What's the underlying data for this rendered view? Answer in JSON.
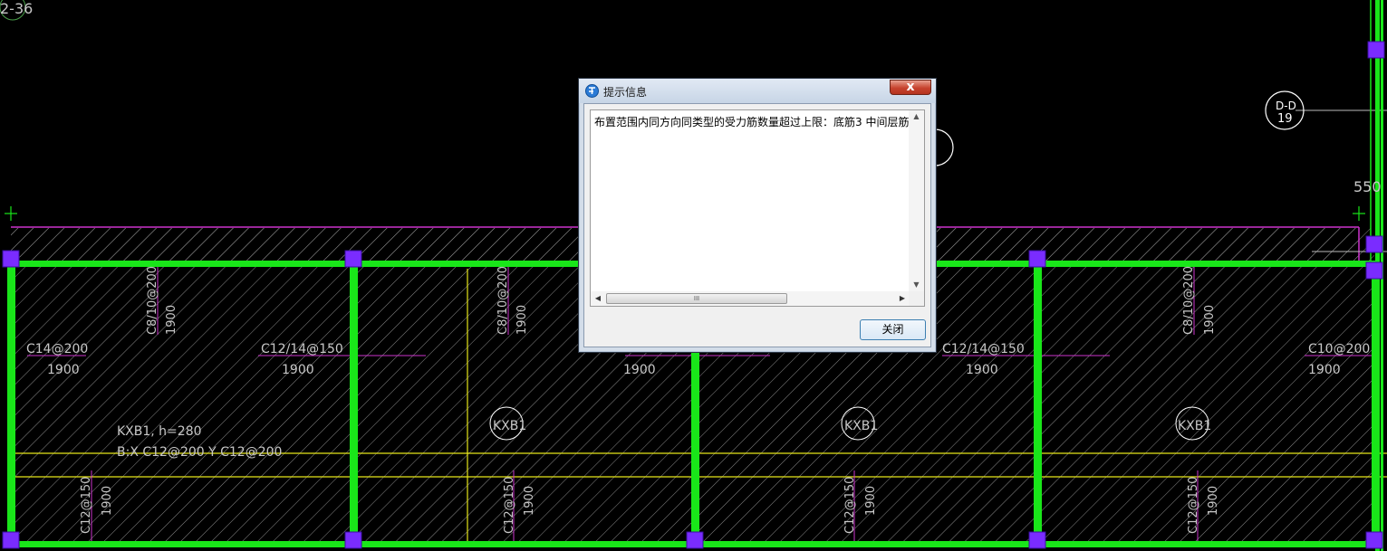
{
  "canvas": {
    "colors": {
      "background": "#000000",
      "beam": "#19e619",
      "magenta": "#cc33cc",
      "yellow": "#e6e619",
      "column": "#7a2cff",
      "text": "#c8c8c8",
      "hatch": "#8a8a8a",
      "bubble": "#ffffff"
    },
    "labels": {
      "corner_label": "2-36",
      "axis_bubble_top": "D-D",
      "axis_bubble_bottom": "19",
      "dim_550": "550",
      "rebar_top_1": "C8/10@200",
      "rebar_top_1_len": "1900",
      "rebar_top_2": "C8/10@200",
      "rebar_top_2_len": "1900",
      "rebar_top_3": "C8/10@200",
      "rebar_top_3_len": "1900",
      "rebar_mid_1": "C14@200",
      "rebar_mid_1_len": "1900",
      "rebar_mid_2": "C12/14@150",
      "rebar_mid_2_len": "1900",
      "rebar_mid_3_len": "1900",
      "rebar_mid_4": "C12/14@150",
      "rebar_mid_4_len": "1900",
      "rebar_mid_5": "C10@200",
      "rebar_mid_5_len": "1900",
      "slab_note_line1": "KXB1, h=280",
      "slab_note_line2": "B:X C12@200 Y C12@200",
      "slab_tag_1": "KXB1",
      "slab_tag_2": "KXB1",
      "slab_tag_3": "KXB1",
      "rebar_bot_1": "C12@150",
      "rebar_bot_1_len": "1900",
      "rebar_bot_2": "C12@150",
      "rebar_bot_2_len": "1900",
      "rebar_bot_3": "C12@150",
      "rebar_bot_3_len": "1900",
      "rebar_bot_4": "C12@150",
      "rebar_bot_4_len": "1900"
    }
  },
  "dialog": {
    "title": "提示信息",
    "close_glyph": "x",
    "message": "布置范围内同方向同类型的受力筋数量超过上限：底筋3  中间层筋",
    "vscroll_up": "▲",
    "vscroll_down": "▼",
    "hscroll_left": "◀",
    "hscroll_right": "▶",
    "hscroll_grip": "III",
    "button_label": "关闭"
  }
}
